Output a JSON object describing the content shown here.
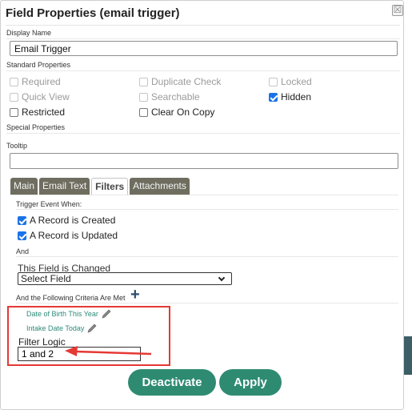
{
  "dialog": {
    "title": "Field Properties (email trigger)",
    "close_glyph": "☒"
  },
  "display_name": {
    "label": "Display Name",
    "value": "Email Trigger"
  },
  "standard_properties": {
    "label": "Standard Properties",
    "checkboxes": [
      {
        "label": "Required",
        "checked": false,
        "disabled": true
      },
      {
        "label": "Duplicate Check",
        "checked": false,
        "disabled": true
      },
      {
        "label": "Locked",
        "checked": false,
        "disabled": true
      },
      {
        "label": "Quick View",
        "checked": false,
        "disabled": true
      },
      {
        "label": "Searchable",
        "checked": false,
        "disabled": true
      },
      {
        "label": "Hidden",
        "checked": true,
        "disabled": false
      },
      {
        "label": "Restricted",
        "checked": false,
        "disabled": false
      },
      {
        "label": "Clear On Copy",
        "checked": false,
        "disabled": false
      }
    ]
  },
  "special_properties": {
    "label": "Special Properties"
  },
  "tooltip": {
    "label": "Tooltip",
    "value": ""
  },
  "tabs": [
    {
      "label": "Main",
      "active": false
    },
    {
      "label": "Email Text",
      "active": false
    },
    {
      "label": "Filters",
      "active": true
    },
    {
      "label": "Attachments",
      "active": false
    }
  ],
  "filters": {
    "trigger_label": "Trigger Event When:",
    "events": [
      {
        "label": "A Record is Created",
        "checked": true
      },
      {
        "label": "A Record is Updated",
        "checked": true
      }
    ],
    "and_label": "And",
    "field_changed_label": "This Field is Changed",
    "select_value": "Select Field",
    "criteria_label": "And the Following Criteria Are Met",
    "criteria": [
      {
        "label": "Date of Birth This Year",
        "icon": "pencil-icon"
      },
      {
        "label": "Intake Date Today",
        "icon": "pencil-icon"
      }
    ],
    "filter_logic_label": "Filter Logic",
    "filter_logic_value": "1 and 2"
  },
  "buttons": {
    "deactivate": "Deactivate",
    "apply": "Apply"
  },
  "colors": {
    "primary_button": "#2e8b72",
    "tab_inactive": "#6f6d5f",
    "criteria_link": "#2e8b7a",
    "annotation_red": "#e53935",
    "checkbox_checked": "#1a73e8"
  }
}
